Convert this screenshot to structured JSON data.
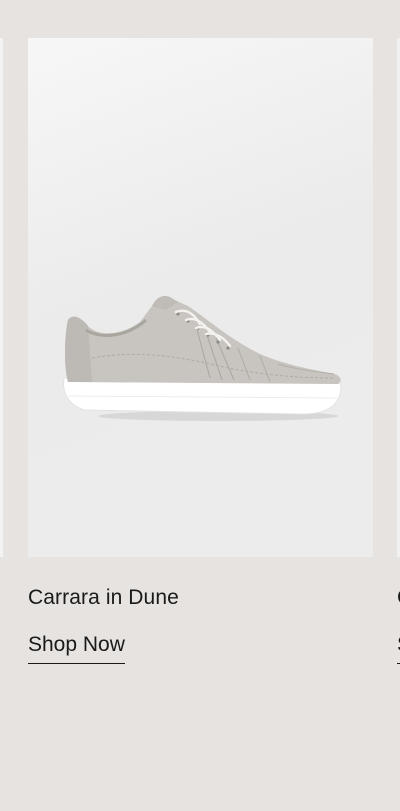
{
  "products": [
    {
      "title": "Carrara in Dune",
      "cta": "Shop Now"
    },
    {
      "title": "C",
      "cta": "S"
    }
  ],
  "colors": {
    "page_background": "#e6e3e0",
    "text": "#1a1a1a",
    "shoe_upper": "#c9c5c0",
    "sole": "#ffffff"
  }
}
